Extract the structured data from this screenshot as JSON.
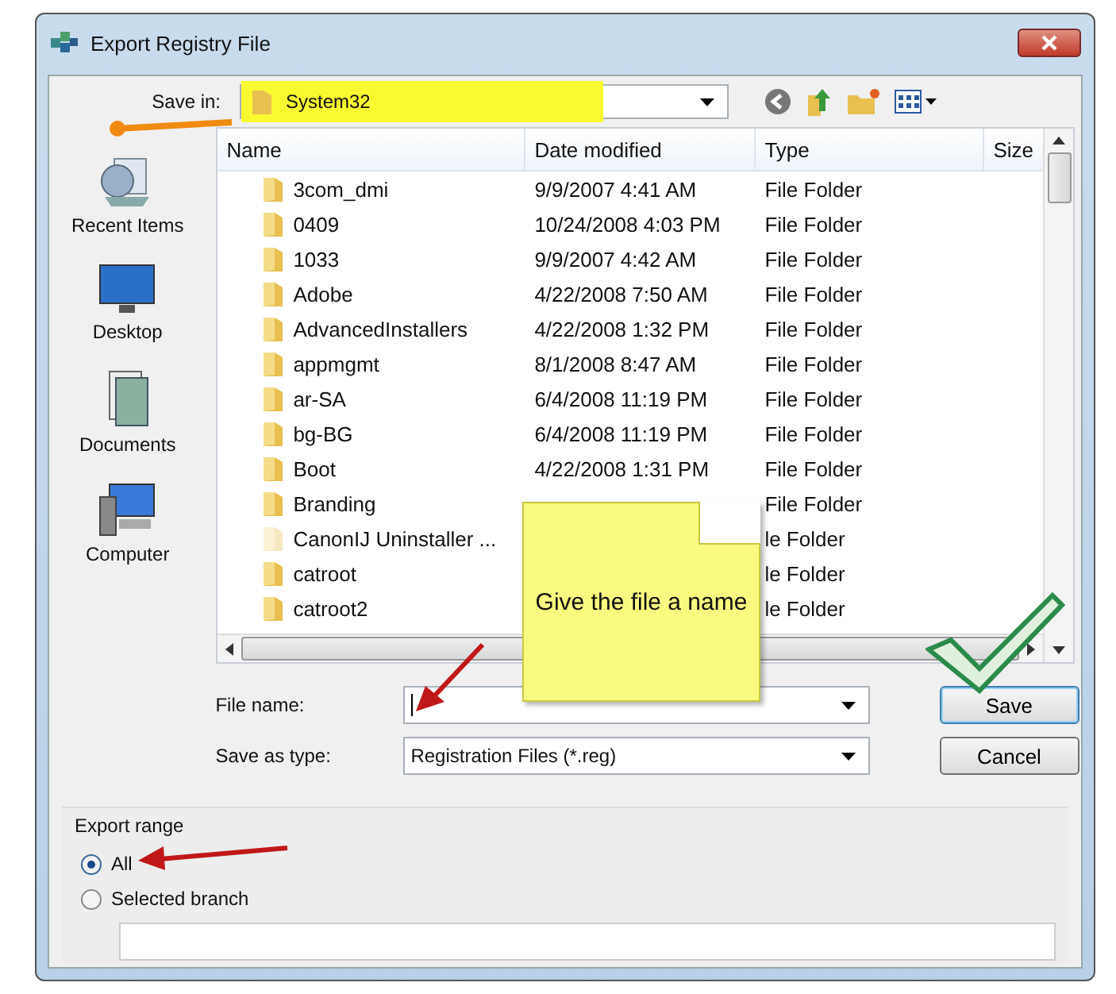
{
  "window": {
    "title": "Export Registry File"
  },
  "save_in": {
    "label": "Save in:",
    "value": "System32"
  },
  "places": [
    {
      "label": "Recent Items",
      "kind": "recent"
    },
    {
      "label": "Desktop",
      "kind": "desktop"
    },
    {
      "label": "Documents",
      "kind": "documents"
    },
    {
      "label": "Computer",
      "kind": "computer"
    }
  ],
  "columns": [
    "Name",
    "Date modified",
    "Type",
    "Size"
  ],
  "rows": [
    {
      "name": "3com_dmi",
      "date": "9/9/2007 4:41 AM",
      "type": "File Folder",
      "hidden": false
    },
    {
      "name": "0409",
      "date": "10/24/2008 4:03 PM",
      "type": "File Folder",
      "hidden": false
    },
    {
      "name": "1033",
      "date": "9/9/2007 4:42 AM",
      "type": "File Folder",
      "hidden": false
    },
    {
      "name": "Adobe",
      "date": "4/22/2008 7:50 AM",
      "type": "File Folder",
      "hidden": false
    },
    {
      "name": "AdvancedInstallers",
      "date": "4/22/2008 1:32 PM",
      "type": "File Folder",
      "hidden": false
    },
    {
      "name": "appmgmt",
      "date": "8/1/2008 8:47 AM",
      "type": "File Folder",
      "hidden": false
    },
    {
      "name": "ar-SA",
      "date": "6/4/2008 11:19 PM",
      "type": "File Folder",
      "hidden": false
    },
    {
      "name": "bg-BG",
      "date": "6/4/2008 11:19 PM",
      "type": "File Folder",
      "hidden": false
    },
    {
      "name": "Boot",
      "date": "4/22/2008 1:31 PM",
      "type": "File Folder",
      "hidden": false
    },
    {
      "name": "Branding",
      "type": "File Folder",
      "hidden": false
    },
    {
      "name": "CanonIJ Uninstaller ...",
      "type": "le Folder",
      "hidden": true
    },
    {
      "name": "catroot",
      "type": "le Folder",
      "hidden": false
    },
    {
      "name": "catroot2",
      "type": "le Folder",
      "hidden": false
    }
  ],
  "file_name": {
    "label": "File name:"
  },
  "save_type": {
    "label": "Save as type:",
    "value": "Registration Files (*.reg)"
  },
  "buttons": [
    {
      "label": "Save",
      "default": true
    },
    {
      "label": "Cancel",
      "default": false
    }
  ],
  "export_range": {
    "title": "Export range",
    "options": [
      {
        "label": "All",
        "selected": true
      },
      {
        "label": "Selected branch",
        "selected": false
      }
    ]
  },
  "annotation": {
    "note": "Give the file a name"
  }
}
